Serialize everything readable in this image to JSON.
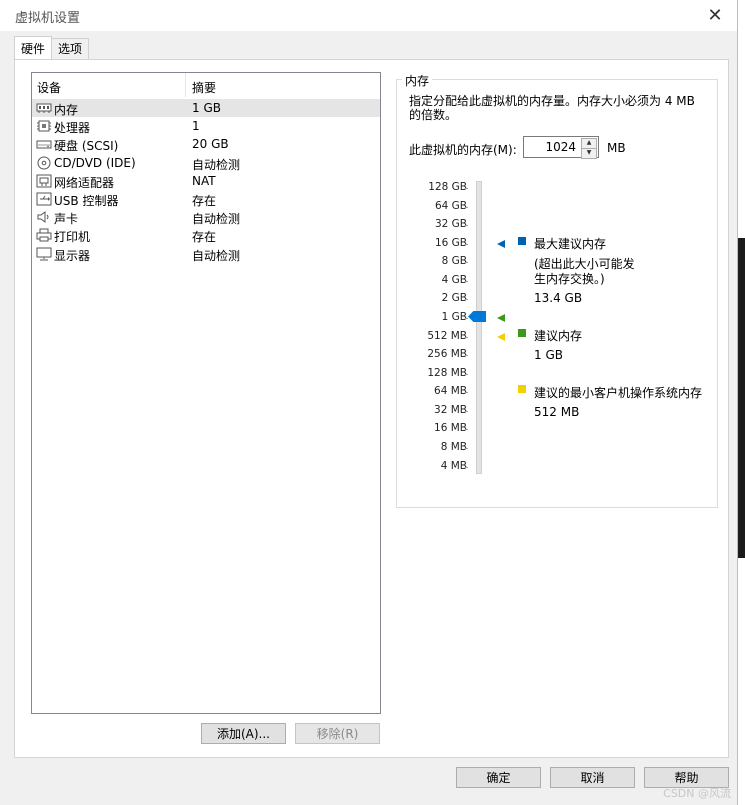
{
  "window": {
    "title": "虚拟机设置",
    "close_icon": "close-icon"
  },
  "tabs": [
    {
      "label": "硬件"
    },
    {
      "label": "选项"
    }
  ],
  "device_list": {
    "col_device": "设备",
    "col_summary": "摘要",
    "rows": [
      {
        "name": "内存",
        "summary": "1 GB",
        "icon": "memory-icon"
      },
      {
        "name": "处理器",
        "summary": "1",
        "icon": "cpu-icon"
      },
      {
        "name": "硬盘 (SCSI)",
        "summary": "20 GB",
        "icon": "harddisk-icon"
      },
      {
        "name": "CD/DVD (IDE)",
        "summary": "自动检测",
        "icon": "cdrom-icon"
      },
      {
        "name": "网络适配器",
        "summary": "NAT",
        "icon": "network-icon"
      },
      {
        "name": "USB 控制器",
        "summary": "存在",
        "icon": "usb-icon"
      },
      {
        "name": "声卡",
        "summary": "自动检测",
        "icon": "speaker-icon"
      },
      {
        "name": "打印机",
        "summary": "存在",
        "icon": "printer-icon"
      },
      {
        "name": "显示器",
        "summary": "自动检测",
        "icon": "monitor-icon"
      }
    ]
  },
  "buttons": {
    "add": "添加(A)...",
    "remove": "移除(R)",
    "ok": "确定",
    "cancel": "取消",
    "help": "帮助"
  },
  "memory": {
    "group_label": "内存",
    "description": "指定分配给此虚拟机的内存量。内存大小必须为 4 MB 的倍数。",
    "field_label": "此虚拟机的内存(M):",
    "value": "1024",
    "unit": "MB",
    "scale": [
      "128 GB",
      "64 GB",
      "32 GB",
      "16 GB",
      "8 GB",
      "4 GB",
      "2 GB",
      "1 GB",
      "512 MB",
      "256 MB",
      "128 MB",
      "64 MB",
      "32 MB",
      "16 MB",
      "8 MB",
      "4 MB"
    ],
    "legend": {
      "max_title": "最大建议内存",
      "max_note": "(超出此大小可能发生内存交换。)",
      "max_value": "13.4 GB",
      "rec_title": "建议内存",
      "rec_value": "1 GB",
      "min_title": "建议的最小客户机操作系统内存",
      "min_value": "512 MB"
    }
  },
  "colors": {
    "max": "#0063b1",
    "rec": "#3c9a1a",
    "min": "#f5d000",
    "thumb": "#0078d7"
  },
  "watermark": "CSDN @风流"
}
